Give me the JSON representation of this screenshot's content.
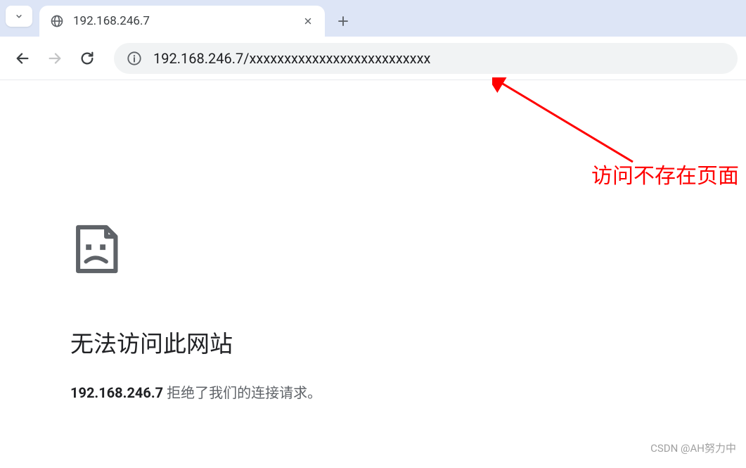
{
  "tab": {
    "title": "192.168.246.7"
  },
  "addressbar": {
    "url": "192.168.246.7/xxxxxxxxxxxxxxxxxxxxxxxxxx"
  },
  "error": {
    "heading": "无法访问此网站",
    "host": "192.168.246.7",
    "message": " 拒绝了我们的连接请求。"
  },
  "annotation": {
    "text": "访问不存在页面"
  },
  "watermark": {
    "text": "CSDN @AH努力中"
  }
}
